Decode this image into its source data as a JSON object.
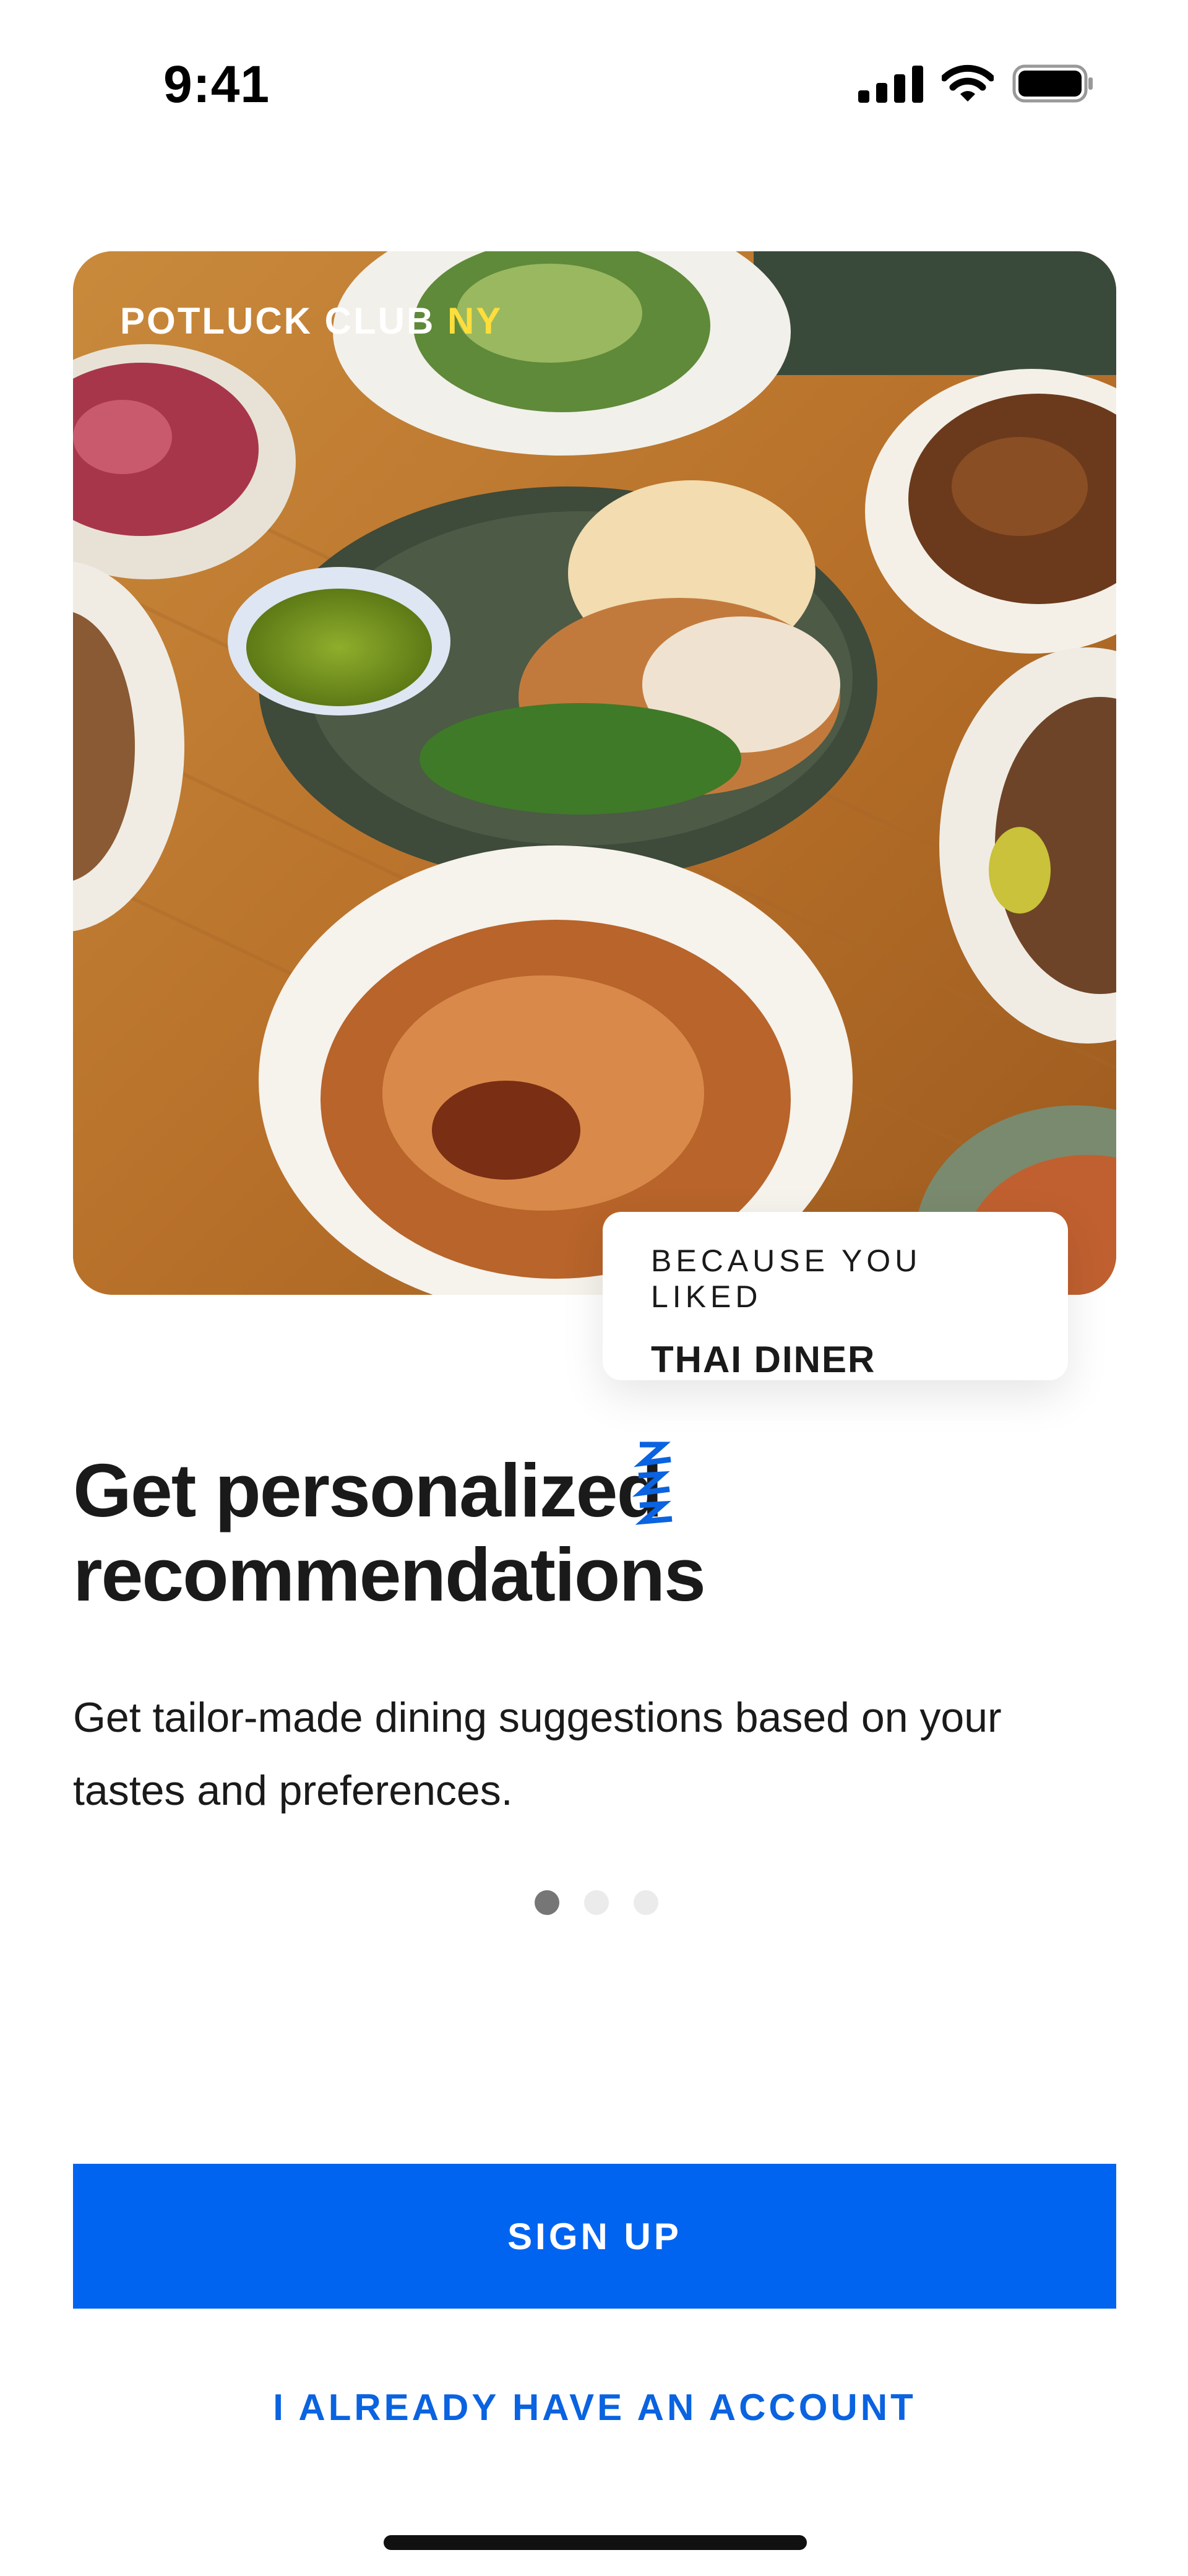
{
  "status_bar": {
    "time": "9:41",
    "icons": [
      "cellular-signal-icon",
      "wifi-icon",
      "battery-icon"
    ]
  },
  "hero": {
    "brand_name": "POTLUCK CLUB",
    "brand_suffix": "NY",
    "image": "food-spread-photo"
  },
  "recommendation_card": {
    "label": "BECAUSE YOU LIKED",
    "restaurant": "THAI DINER"
  },
  "onboarding": {
    "title_line1": "Get personalized",
    "title_line2": "recommendations",
    "description": "Get tailor-made dining suggestions based on your tastes and preferences.",
    "pages": 3,
    "current_page": 1
  },
  "actions": {
    "signup_label": "SIGN UP",
    "login_label": "I ALREADY HAVE AN ACCOUNT"
  },
  "colors": {
    "primary": "#0064f0",
    "brand_accent": "#ffde3b",
    "text": "#1a1a1a"
  }
}
